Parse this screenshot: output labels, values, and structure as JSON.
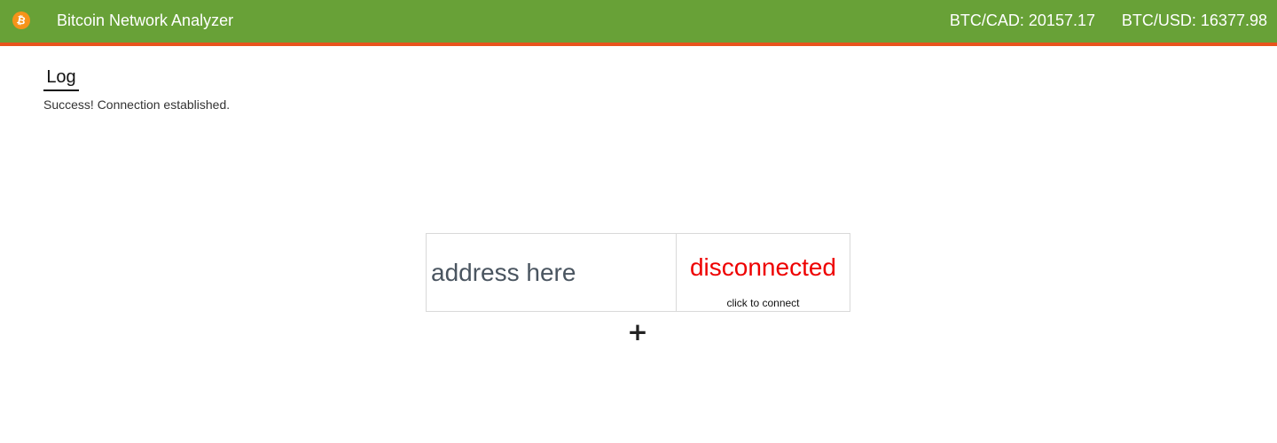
{
  "header": {
    "logo_icon": "bitcoin-icon",
    "logo_glyph": "₿",
    "title": "Bitcoin Network Analyzer",
    "rates": [
      {
        "label": "BTC/CAD: 20157.17"
      },
      {
        "label": "BTC/USD: 16377.98"
      }
    ],
    "colors": {
      "bar": "#68a137",
      "accent_border": "#e8541c",
      "logo": "#f7931a"
    }
  },
  "log": {
    "heading": "Log",
    "message": "Success! Connection established."
  },
  "node": {
    "address_placeholder": "address here",
    "status": "disconnected",
    "hint": "click to connect",
    "status_color": "#ee0000"
  },
  "add_button": {
    "label": "+",
    "icon": "plus-icon"
  }
}
